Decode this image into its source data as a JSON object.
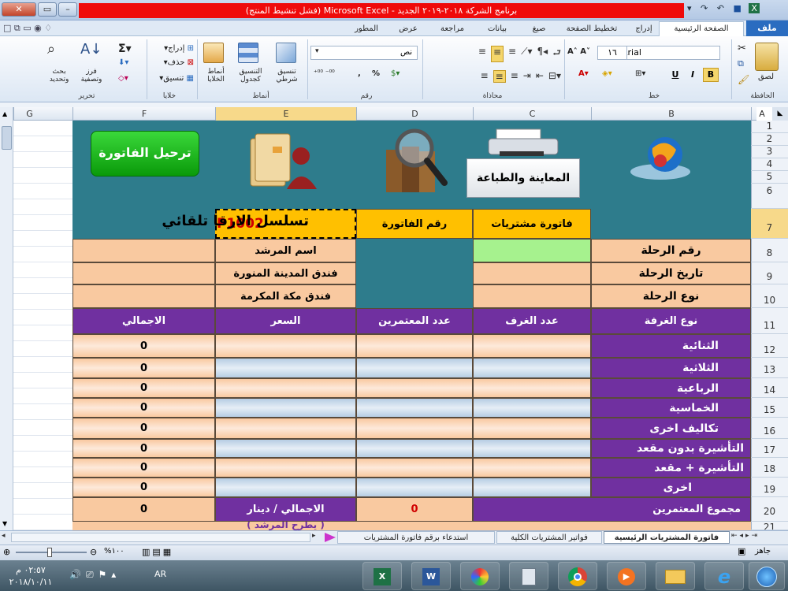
{
  "app": {
    "title": "برنامج الشركة ٢٠١٨-٢٠١٩ الجديد - Microsoft Excel (فشل تنشيط المنتج)"
  },
  "ribbon_tabs": [
    "ملف",
    "الصفحة الرئيسية",
    "إدراج",
    "تخطيط الصفحة",
    "صيغ",
    "بيانات",
    "مراجعة",
    "عرض",
    "المطور"
  ],
  "ribbon": {
    "groups": [
      "الحافظة",
      "خط",
      "محاذاة",
      "رقم",
      "أنماط",
      "خلايا",
      "تحرير"
    ],
    "paste": "لصق",
    "font_name": "Arial",
    "font_size": "١٦",
    "number_format": "نص",
    "conditional": "تنسيق شرطي",
    "format_table": "التنسيق كجدول",
    "cell_styles": "أنماط الخلايا",
    "insert": "إدراج",
    "delete": "حذف",
    "format": "تنسيق",
    "sort": "فرز وتصفية",
    "find": "بحث وتحديد",
    "bold": "B",
    "italic": "I",
    "underline": "U",
    "percent": "%",
    "comma": ","
  },
  "columns": [
    "G",
    "F",
    "E",
    "D",
    "C",
    "B",
    "A"
  ],
  "rows": [
    "1",
    "2",
    "3",
    "4",
    "5",
    "6",
    "7",
    "8",
    "9",
    "10",
    "11",
    "12",
    "13",
    "14",
    "15",
    "16",
    "17",
    "18",
    "19",
    "20",
    "21"
  ],
  "buttons": {
    "transfer": "ترحيل الفاتورة",
    "preview": "المعاينة والطباعة"
  },
  "header": {
    "invoice_type": "فاتورة مشتريات",
    "invoice_no_label": "رقم الفاتورة",
    "serial_code": "P1002",
    "serial_text": "تسلسل الارقا تلقائي"
  },
  "trip": {
    "no": "رقم الرحلة",
    "date": "تاريخ الرحلة",
    "type": "نوع الرحلة",
    "guide": "اسم المرشد",
    "hotel_madinah": "فندق المدينة المنورة",
    "hotel_makkah": "فندق مكة المكرمة"
  },
  "table": {
    "headers": [
      "نوع الغرفة",
      "عدد الغرف",
      "عدد المعتمرين",
      "السعر",
      "الاجمالي"
    ],
    "rows": [
      {
        "type": "الثنائية",
        "total": "0"
      },
      {
        "type": "الثلاثية",
        "total": "0"
      },
      {
        "type": "الرباعية",
        "total": "0"
      },
      {
        "type": "الخماسية",
        "total": "0"
      },
      {
        "type": "تكاليف اخرى",
        "total": "0"
      },
      {
        "type": "التأشيرة بدون مقعد",
        "total": "0"
      },
      {
        "type": "التأشيرة + مقعد",
        "total": "0"
      },
      {
        "type": "اخرى",
        "total": "0"
      }
    ],
    "pilgrims_total_label": "مجموع المعتمرين",
    "pilgrims_total": "0",
    "grand_total_label": "الاجمالي / دينار",
    "grand_total": "0",
    "partial_row": "( يطرح المرشد )"
  },
  "sheet_tabs": [
    "فاتورة المشتريات الرئيسية",
    "فواتير المشتريات الكلية",
    "استدعاء برقم فاتورة المشتريات"
  ],
  "status": {
    "ready": "جاهز",
    "zoom": "%١٠٠"
  },
  "taskbar": {
    "lang": "AR",
    "time": "٠٢:٥٧ م",
    "date": "٢٠١٨/١٠/١١"
  }
}
